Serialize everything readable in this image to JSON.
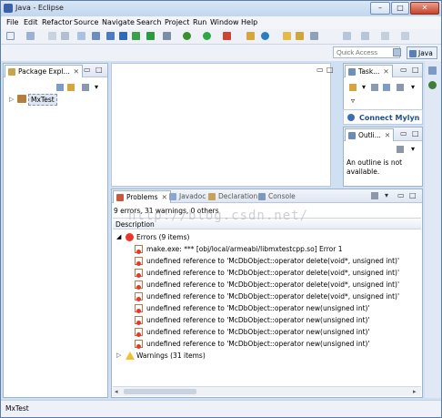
{
  "window": {
    "title": "Java - Eclipse",
    "minimize": "–",
    "maximize": "□",
    "close": "✕"
  },
  "menu": [
    "File",
    "Edit",
    "Refactor",
    "Source",
    "Navigate",
    "Search",
    "Project",
    "Run",
    "Window",
    "Help"
  ],
  "quick_access": {
    "placeholder": "Quick Access"
  },
  "perspective": {
    "label": "Java"
  },
  "package_explorer": {
    "tab_label": "Package Expl...",
    "project": "MxTest"
  },
  "task_list": {
    "tab_label": "Task..."
  },
  "mylyn": {
    "label": "Connect Mylyn"
  },
  "outline": {
    "tab_label": "Outli...",
    "message": "An outline is not available."
  },
  "bottom_tabs": {
    "problems": "Problems",
    "javadoc": "Javadoc",
    "declaration": "Declaration",
    "console": "Console"
  },
  "problems": {
    "summary": "9 errors, 31 warnings, 0 others",
    "column_header": "Description",
    "errors_group": "Errors (9 items)",
    "errors": [
      "make.exe: *** [obj/local/armeabi/libmxtestcpp.so] Error 1",
      "undefined reference to 'McDbObject::operator delete(void*, unsigned int)'",
      "undefined reference to 'McDbObject::operator delete(void*, unsigned int)'",
      "undefined reference to 'McDbObject::operator delete(void*, unsigned int)'",
      "undefined reference to 'McDbObject::operator delete(void*, unsigned int)'",
      "undefined reference to 'McDbObject::operator new(unsigned int)'",
      "undefined reference to 'McDbObject::operator new(unsigned int)'",
      "undefined reference to 'McDbObject::operator new(unsigned int)'",
      "undefined reference to 'McDbObject::operator new(unsigned int)'"
    ],
    "warnings_group": "Warnings (31 items)"
  },
  "watermark": "http://blog.csdn.net/",
  "status_bar": {
    "text": "MxTest"
  },
  "colors": {
    "accent": "#3b62a8",
    "error": "#e8372a",
    "warning": "#f2c02f"
  }
}
